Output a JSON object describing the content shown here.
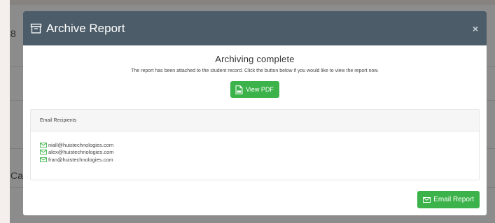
{
  "background": {
    "fragment_top": "8",
    "fragment_bottom": "Ca"
  },
  "modal": {
    "title": "Archive Report",
    "close_label": "×",
    "heading": "Archiving complete",
    "message": "The report has been attached to the student record. Click the button below if you would like to view the report now.",
    "view_pdf_label": "View PDF",
    "email_section": {
      "title": "Email Recipients",
      "recipients": [
        "niall@huistechnologies.com",
        "alex@huistechnologies.com",
        "fran@huistechnologies.com"
      ]
    },
    "email_report_label": "Email Report"
  },
  "colors": {
    "header_bg": "#4c5d69",
    "button_green": "#3cb34a"
  }
}
